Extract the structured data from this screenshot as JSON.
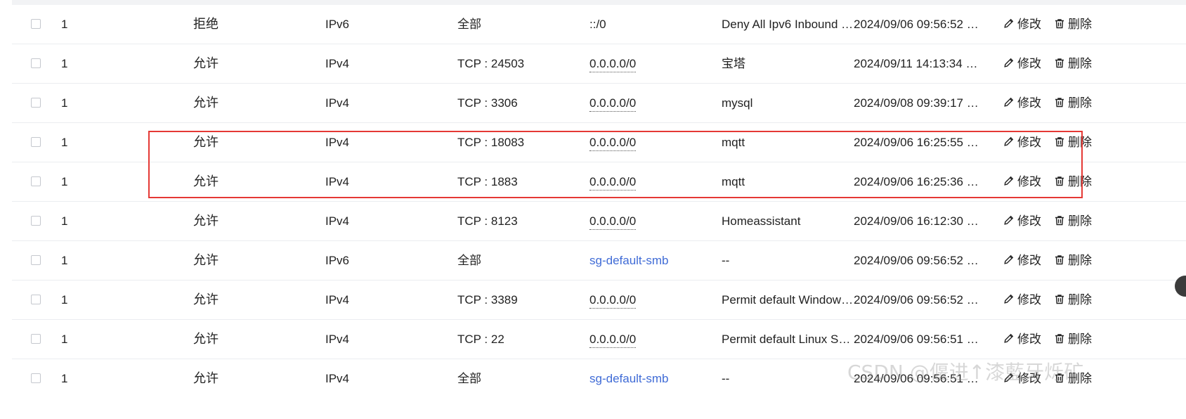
{
  "actions": {
    "edit_label": "修改",
    "delete_label": "删除"
  },
  "rows": [
    {
      "priority": "1",
      "policy": "拒绝",
      "type": "IPv6",
      "port": "全部",
      "source": "::/0",
      "source_style": "plain",
      "description": "Deny All Ipv6 Inbound …",
      "time": "2024/09/06 09:56:52 G…"
    },
    {
      "priority": "1",
      "policy": "允许",
      "type": "IPv4",
      "port": "TCP : 24503",
      "source": "0.0.0.0/0",
      "source_style": "dotted",
      "description": "宝塔",
      "time": "2024/09/11 14:13:34 G…"
    },
    {
      "priority": "1",
      "policy": "允许",
      "type": "IPv4",
      "port": "TCP : 3306",
      "source": "0.0.0.0/0",
      "source_style": "dotted",
      "description": "mysql",
      "time": "2024/09/08 09:39:17 G…"
    },
    {
      "priority": "1",
      "policy": "允许",
      "type": "IPv4",
      "port": "TCP : 18083",
      "source": "0.0.0.0/0",
      "source_style": "dotted",
      "description": "mqtt",
      "time": "2024/09/06 16:25:55 G…"
    },
    {
      "priority": "1",
      "policy": "允许",
      "type": "IPv4",
      "port": "TCP : 1883",
      "source": "0.0.0.0/0",
      "source_style": "dotted",
      "description": "mqtt",
      "time": "2024/09/06 16:25:36 G…"
    },
    {
      "priority": "1",
      "policy": "允许",
      "type": "IPv4",
      "port": "TCP : 8123",
      "source": "0.0.0.0/0",
      "source_style": "dotted",
      "description": "Homeassistant",
      "time": "2024/09/06 16:12:30 G…"
    },
    {
      "priority": "1",
      "policy": "允许",
      "type": "IPv6",
      "port": "全部",
      "source": "sg-default-smb",
      "source_style": "link",
      "description": "--",
      "time": "2024/09/06 09:56:52 G…"
    },
    {
      "priority": "1",
      "policy": "允许",
      "type": "IPv4",
      "port": "TCP : 3389",
      "source": "0.0.0.0/0",
      "source_style": "dotted",
      "description": "Permit default Windows…",
      "time": "2024/09/06 09:56:52 G…"
    },
    {
      "priority": "1",
      "policy": "允许",
      "type": "IPv4",
      "port": "TCP : 22",
      "source": "0.0.0.0/0",
      "source_style": "dotted",
      "description": "Permit default Linux SS…",
      "time": "2024/09/06 09:56:51 G…"
    },
    {
      "priority": "1",
      "policy": "允许",
      "type": "IPv4",
      "port": "全部",
      "source": "sg-default-smb",
      "source_style": "link",
      "description": "--",
      "time": "2024/09/06 09:56:51 G…"
    }
  ],
  "watermark": "CSDN @偃进↑漆藍牙烁矿",
  "colors": {
    "link": "#3f6bd6",
    "highlight": "#e53935"
  }
}
